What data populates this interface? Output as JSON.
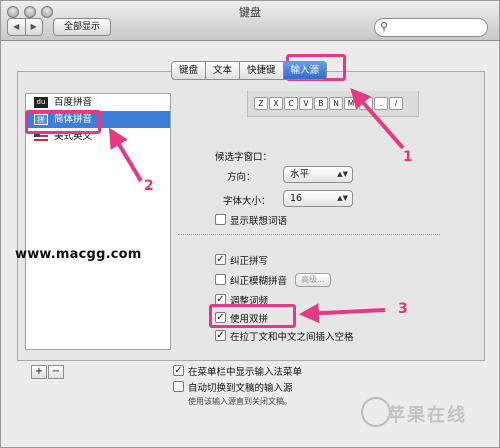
{
  "window": {
    "title": "键盘",
    "show_all": "全部显示",
    "nav_back": "◀",
    "nav_forward": "▶",
    "search_placeholder": ""
  },
  "tabs": [
    {
      "label": "键盘",
      "active": false
    },
    {
      "label": "文本",
      "active": false
    },
    {
      "label": "快捷键",
      "active": false
    },
    {
      "label": "输入源",
      "active": true
    }
  ],
  "input_sources": [
    {
      "label": "百度拼音",
      "icon": "du",
      "selected": false
    },
    {
      "label": "简体拼音",
      "icon": "jian",
      "selected": true
    },
    {
      "label": "美式英文",
      "icon": "us-flag",
      "selected": false
    }
  ],
  "keyboard_keys": [
    "Z",
    "X",
    "C",
    "V",
    "B",
    "N",
    "M",
    ",",
    ".",
    "/"
  ],
  "candidate": {
    "heading": "候选字窗口：",
    "direction_label": "方向：",
    "direction_value": "水平",
    "font_size_label": "字体大小：",
    "font_size_value": "16",
    "show_assoc": {
      "label": "显示联想词语",
      "checked": false
    }
  },
  "options": [
    {
      "label": "纠正拼写",
      "checked": true
    },
    {
      "label": "纠正模糊拼音",
      "checked": false,
      "button": "高级..."
    },
    {
      "label": "调整词频",
      "checked": true
    },
    {
      "label": "使用双拼",
      "checked": true
    },
    {
      "label": "在拉丁文和中文之间插入空格",
      "checked": true
    }
  ],
  "bottom": {
    "add": "+",
    "remove": "−",
    "show_menu": {
      "label": "在菜单栏中显示输入法菜单",
      "checked": true
    },
    "auto_switch": {
      "label": "自动切换到文稿的输入源",
      "checked": false
    },
    "hint": "使用该输入源直到关闭文稿。"
  },
  "annotations": {
    "watermark": "www.macgg.com",
    "step1": "1",
    "step2": "2",
    "step3": "3",
    "highlight_color": "#e33a83"
  },
  "brand": {
    "text": "苹果在线"
  }
}
